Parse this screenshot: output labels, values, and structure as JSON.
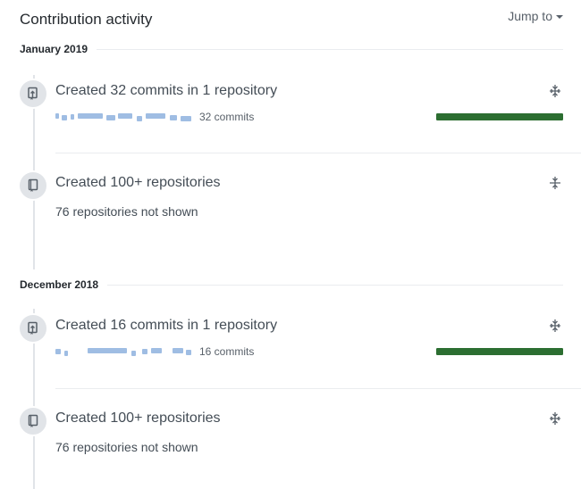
{
  "header": {
    "title": "Contribution activity",
    "jump_to_label": "Jump to"
  },
  "months": [
    {
      "label": "January 2019",
      "items": [
        {
          "type": "commits",
          "title": "Created 32 commits in 1 repository",
          "repo_count_label": "32 commits",
          "progress": 1.0,
          "icon": "repo-push-icon"
        },
        {
          "type": "repositories",
          "title": "Created 100+ repositories",
          "not_shown": "76 repositories not shown",
          "icon": "repo-icon"
        }
      ]
    },
    {
      "label": "December 2018",
      "items": [
        {
          "type": "commits",
          "title": "Created 16 commits in 1 repository",
          "repo_count_label": "16 commits",
          "progress": 1.0,
          "icon": "repo-push-icon"
        },
        {
          "type": "repositories",
          "title": "Created 100+ repositories",
          "not_shown": "76 repositories not shown",
          "icon": "repo-icon"
        }
      ]
    }
  ],
  "colors": {
    "progress_fill": "#2c6e31",
    "badge_bg": "#e1e4e8",
    "text_primary": "#24292e",
    "text_muted": "#586069"
  }
}
